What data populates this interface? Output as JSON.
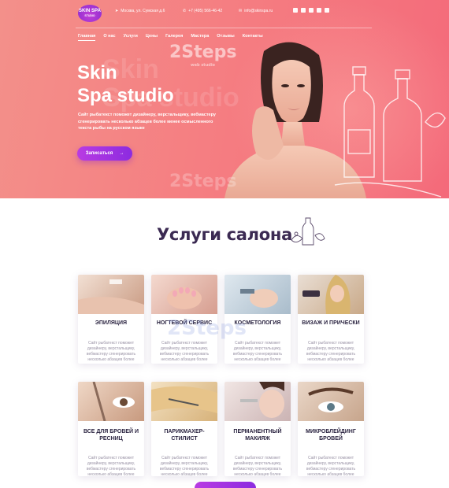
{
  "header": {
    "logo": [
      "SKIN SPA",
      "STUDIO"
    ],
    "address": "Москва, ул. Сумская д.6",
    "phone": "+7 (495) 566-46-42",
    "email": "info@skinspa.ru"
  },
  "nav": [
    "Главная",
    "О нас",
    "Услуги",
    "Цены",
    "Галерея",
    "Мастера",
    "Отзывы",
    "Контакты"
  ],
  "hero": {
    "title_line1": "Skin",
    "title_line2": "Spa studio",
    "subtitle": "Сайт рыбатекст поможет дизайнеру, верстальщику, вебмастеру сгенерировать несколько абзацев более менее осмысленного текста рыбы на русском языке",
    "cta": "Записаться",
    "cta_arrow": "→"
  },
  "services": {
    "title": "Услуги салона",
    "items": [
      {
        "name": "ЭПИЛЯЦИЯ",
        "desc": "Сайт рыбатекст поможет дизайнеру, верстальщику, вебмастеру сгенерировать несколько абзацев более"
      },
      {
        "name": "НОГТЕВОЙ СЕРВИС",
        "desc": "Сайт рыбатекст поможет дизайнеру, верстальщику, вебмастеру сгенерировать несколько абзацев более"
      },
      {
        "name": "КОСМЕТОЛОГИЯ",
        "desc": "Сайт рыбатекст поможет дизайнеру, верстальщику, вебмастеру сгенерировать несколько абзацев более"
      },
      {
        "name": "ВИЗАЖ И ПРИЧЕСКИ",
        "desc": "Сайт рыбатекст поможет дизайнеру, верстальщику, вебмастеру сгенерировать несколько абзацев более"
      },
      {
        "name": "ВСЕ ДЛЯ БРОВЕЙ И РЕСНИЦ",
        "desc": "Сайт рыбатекст поможет дизайнеру, верстальщику, вебмастеру сгенерировать несколько абзацев более"
      },
      {
        "name": "ПАРИКМАХЕР-СТИЛИСТ",
        "desc": "Сайт рыбатекст поможет дизайнеру, верстальщику, вебмастеру сгенерировать несколько абзацев более"
      },
      {
        "name": "ПЕРМАНЕНТНЫЙ МАКИЯЖ",
        "desc": "Сайт рыбатекст поможет дизайнеру, верстальщику, вебмастеру сгенерировать несколько абзацев более"
      },
      {
        "name": "МИКРОБЛЕЙДИНГ БРОВЕЙ",
        "desc": "Сайт рыбатекст поможет дизайнеру, верстальщику, вебмастеру сгенерировать несколько абзацев более"
      }
    ]
  },
  "watermark": {
    "brand": "2Steps",
    "tag": "web studio"
  },
  "colors": {
    "hero": "#f57f82",
    "accent": "#a433e0",
    "heading": "#3b2a52"
  }
}
